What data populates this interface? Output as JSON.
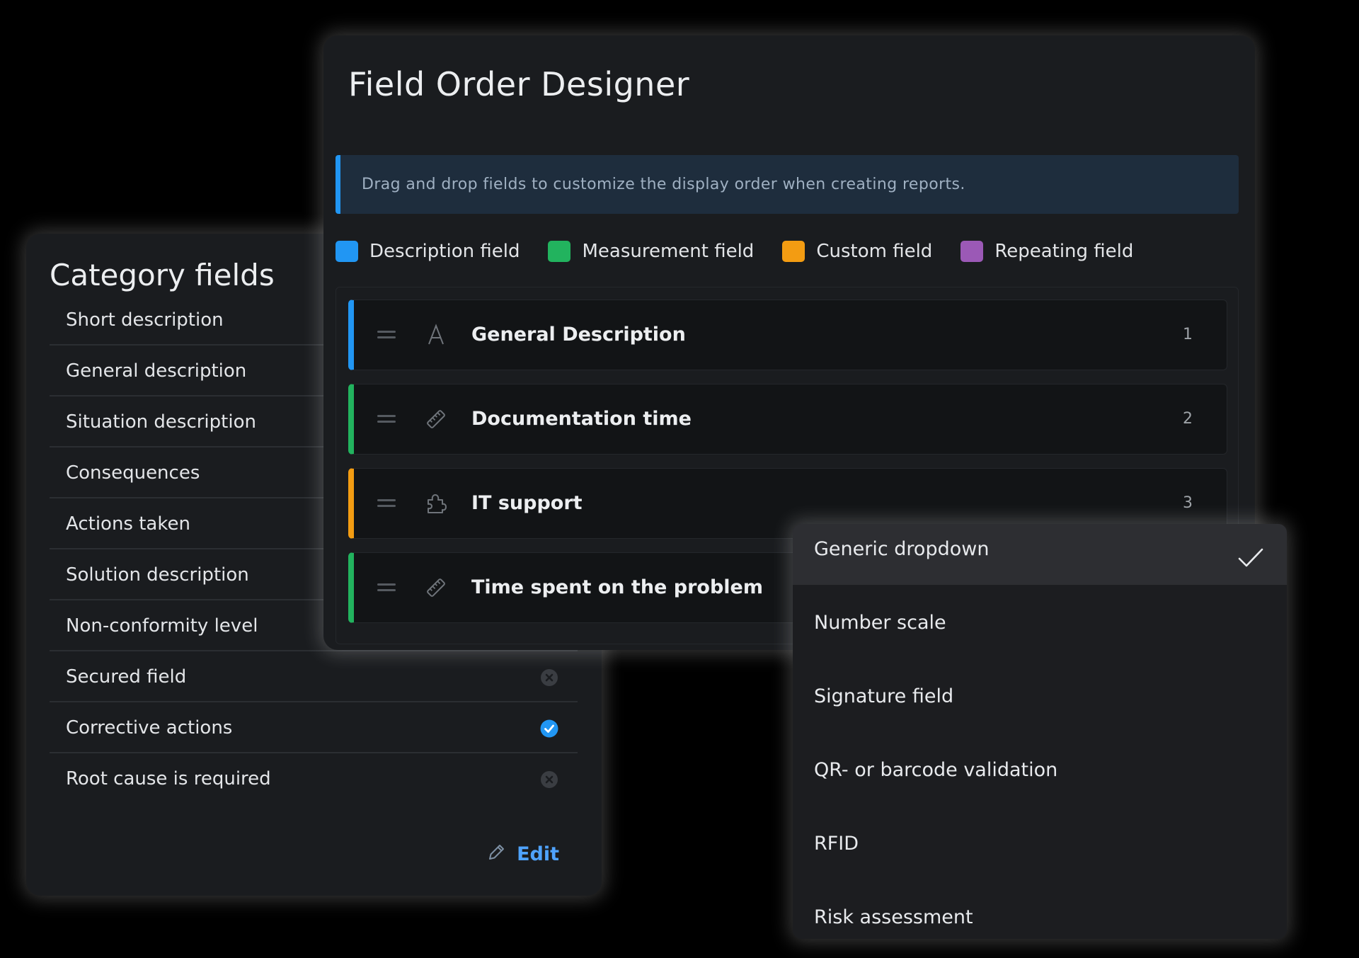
{
  "category_fields": {
    "title": "Category fields",
    "items": [
      {
        "label": "Short description"
      },
      {
        "label": "General description"
      },
      {
        "label": "Situation description"
      },
      {
        "label": "Consequences"
      },
      {
        "label": "Actions taken"
      },
      {
        "label": "Solution description"
      },
      {
        "label": "Non-conformity level"
      },
      {
        "label": "Secured field",
        "status": "disabled"
      },
      {
        "label": "Corrective actions",
        "status": "enabled"
      },
      {
        "label": "Root cause is required",
        "status": "disabled"
      }
    ],
    "edit_label": "Edit"
  },
  "designer": {
    "title": "Field Order Designer",
    "info": "Drag and drop fields to customize the display order when creating reports.",
    "legend": [
      {
        "label": "Description field",
        "color": "#2196f3"
      },
      {
        "label": "Measurement field",
        "color": "#22b35e"
      },
      {
        "label": "Custom field",
        "color": "#f39c12"
      },
      {
        "label": "Repeating field",
        "color": "#9b59b6"
      }
    ],
    "fields": [
      {
        "label": "General Description",
        "order": "1",
        "type": "description",
        "icon": "text-icon",
        "color": "#2196f3"
      },
      {
        "label": "Documentation time",
        "order": "2",
        "type": "measurement",
        "icon": "ruler-icon",
        "color": "#22b35e"
      },
      {
        "label": "IT support",
        "order": "3",
        "type": "custom",
        "icon": "puzzle-icon",
        "color": "#f39c12"
      },
      {
        "label": "Time spent on the problem",
        "order": "",
        "type": "measurement",
        "icon": "ruler-icon",
        "color": "#22b35e"
      }
    ]
  },
  "dropdown": {
    "selected": "Generic dropdown",
    "options": [
      {
        "label": "Generic dropdown"
      },
      {
        "label": "Number scale"
      },
      {
        "label": "Signature field"
      },
      {
        "label": "QR- or barcode validation"
      },
      {
        "label": "RFID"
      },
      {
        "label": "Risk assessment"
      }
    ]
  },
  "colors": {
    "accent_blue": "#4fa3ff",
    "check_blue": "#2196f3",
    "disabled_gray": "#3a3d42"
  }
}
